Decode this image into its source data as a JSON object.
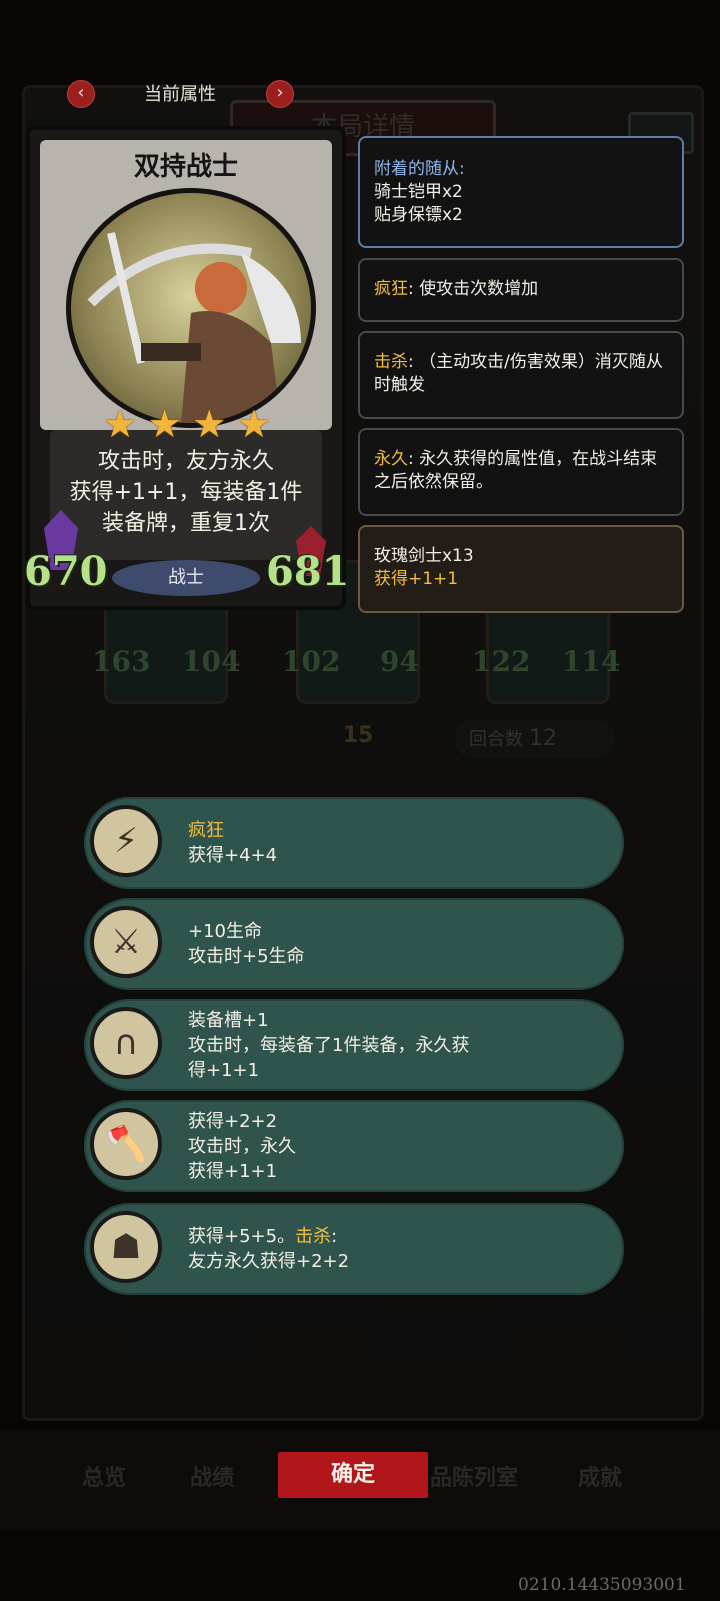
{
  "header": {
    "title": "当前属性",
    "prev_icon": "‹",
    "next_icon": "›"
  },
  "background": {
    "title": "本局详情",
    "round_label": "回合数",
    "round_value": "12",
    "turn_value": "15",
    "units": [
      {
        "atk": "163",
        "hp": "104"
      },
      {
        "atk": "102",
        "hp": "94"
      },
      {
        "atk": "122",
        "hp": "114"
      }
    ],
    "tabs": [
      "总览",
      "战绩",
      "品陈列室",
      "成就"
    ]
  },
  "card": {
    "name": "双持战士",
    "stars": 4,
    "description_lines": [
      "攻击时，友方永久",
      "获得+1+1，每装备1件",
      "装备牌，重复1次"
    ],
    "tribe": "战士",
    "attack": "670",
    "health": "681"
  },
  "tooltips": {
    "attached_title": "附着的随从:",
    "attached_items": [
      "骑士铠甲x2",
      "贴身保镖x2"
    ],
    "frenzy_kw": "疯狂",
    "frenzy_text": ": 使攻击次数增加",
    "kill_kw": "击杀",
    "kill_text": ": （主动攻击/伤害效果）消灭随从时触发",
    "perm_kw": "永久",
    "perm_text": ": 永久获得的属性值，在战斗结束之后依然保留。",
    "rose_title": "玫瑰剑士x13",
    "rose_text": "获得+1+1"
  },
  "perks": [
    {
      "icon": "lightning-shield-icon",
      "glyph": "⚡",
      "kw": "疯狂",
      "lines": [
        "获得+4+4"
      ]
    },
    {
      "icon": "flail-icon",
      "glyph": "⚔",
      "lines": [
        "+10生命",
        "攻击时+5生命"
      ]
    },
    {
      "icon": "horseshoe-icon",
      "glyph": "∩",
      "lines": [
        "装备槽+1",
        "攻击时，每装备了1件装备，永久获",
        "得+1+1"
      ]
    },
    {
      "icon": "axe-icon",
      "glyph": "🪓",
      "lines": [
        "获得+2+2",
        "攻击时，永久",
        "获得+1+1"
      ]
    },
    {
      "icon": "hooded-figure-icon",
      "glyph": "☗",
      "line1_pre": "获得+5+5。",
      "line1_kw": "击杀",
      "line1_post": ":",
      "lines": [
        "友方永久获得+2+2"
      ]
    }
  ],
  "confirm_label": "确定",
  "build_id": "0210.14435093001",
  "colors": {
    "accent_gold": "#f2bd3d",
    "stat_green": "#b6e08a",
    "perk_bg": "#2f544d",
    "confirm_red": "#b0161a"
  }
}
